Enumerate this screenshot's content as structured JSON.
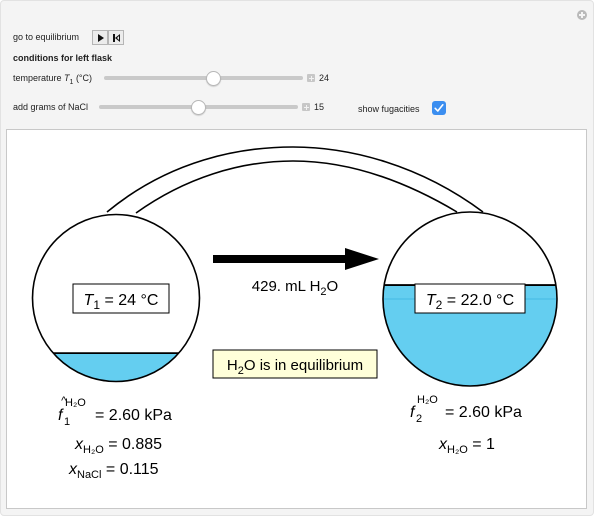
{
  "controls": {
    "go_to_equilibrium_label": "go to equilibrium",
    "play_button": "play-icon",
    "reset_button": "reset-icon",
    "section_heading": "conditions for left flask",
    "temperature": {
      "label_prefix": "temperature ",
      "label_var": "T",
      "label_sub": "1",
      "label_suffix": " (°C)",
      "value": "24",
      "fraction": 0.55
    },
    "nacl": {
      "label": "add grams of NaCl",
      "value": "15",
      "fraction": 0.5
    },
    "show_fugacities": {
      "label": "show fugacities",
      "checked": true
    },
    "accent_color": "#3b8ef0"
  },
  "diagram": {
    "liquid_color": "#64cef0",
    "left_flask": {
      "temp_var": "T",
      "temp_sub": "1",
      "temp_rest": " = 24 °C",
      "liquid_fill_fraction": 0.17,
      "fugacity_symbol": "f",
      "fugacity_hat": "^",
      "fugacity_sub": "1",
      "fugacity_sup": "H₂O",
      "fugacity_value": " = 2.60 kPa",
      "x_h2o_symbol": "x",
      "x_h2o_sub": "H₂O",
      "x_h2o_value": " = 0.885",
      "x_nacl_symbol": "x",
      "x_nacl_sub": "NaCl",
      "x_nacl_value": " = 0.115"
    },
    "right_flask": {
      "temp_var": "T",
      "temp_sub": "2",
      "temp_rest": " = 22.0 °C",
      "liquid_fill_fraction": 0.58,
      "fugacity_symbol": "f",
      "fugacity_sub": "2",
      "fugacity_sup": "H₂O",
      "fugacity_value": " = 2.60 kPa",
      "x_h2o_symbol": "x",
      "x_h2o_sub": "H₂O",
      "x_h2o_value": " = 1"
    },
    "transfer": {
      "amount": "429. mL H",
      "sub": "2",
      "tail": "O",
      "direction": "left-to-right"
    },
    "status": {
      "prefix": "H",
      "sub": "2",
      "rest": "O is in equilibrium",
      "background": "#ffffd9"
    }
  }
}
